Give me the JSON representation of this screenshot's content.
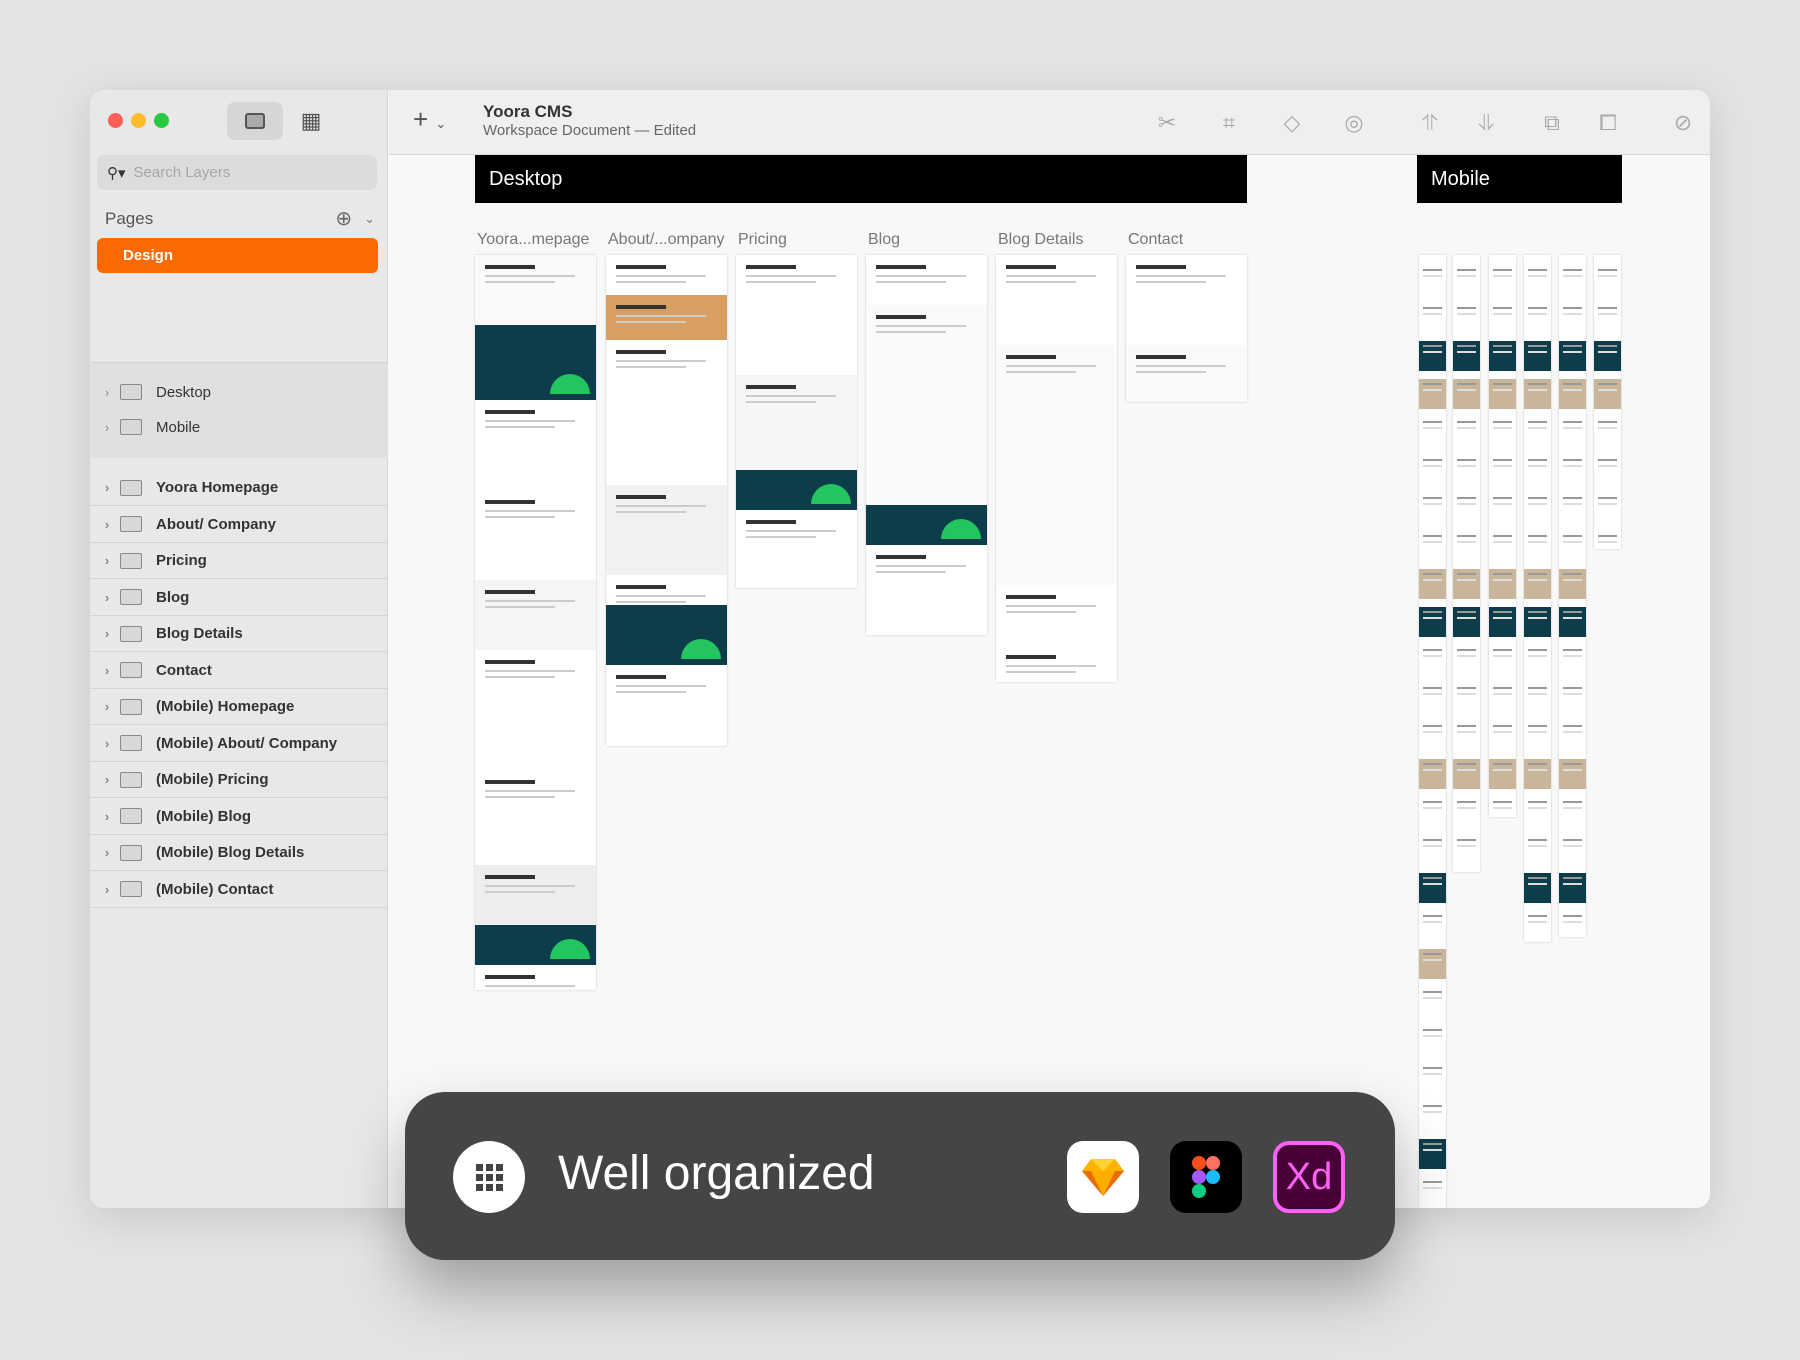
{
  "window": {
    "title": "Yoora CMS",
    "subtitle": "Workspace Document — Edited"
  },
  "sidebar": {
    "search_placeholder": "Search Layers",
    "pages_label": "Pages",
    "active_page": "Design",
    "groups": [
      {
        "label": "Desktop"
      },
      {
        "label": "Mobile"
      }
    ],
    "artboards": [
      {
        "label": "Yoora Homepage"
      },
      {
        "label": "About/ Company"
      },
      {
        "label": "Pricing"
      },
      {
        "label": "Blog"
      },
      {
        "label": "Blog Details"
      },
      {
        "label": "Contact"
      },
      {
        "label": "(Mobile) Homepage"
      },
      {
        "label": "(Mobile) About/ Company"
      },
      {
        "label": "(Mobile) Pricing"
      },
      {
        "label": "(Mobile) Blog"
      },
      {
        "label": "(Mobile) Blog Details"
      },
      {
        "label": "(Mobile) Contact"
      }
    ]
  },
  "toolbar": {
    "icons": [
      "scissors-icon",
      "frame-icon",
      "symbol-icon",
      "mask-icon",
      "forward-icon",
      "backward-icon",
      "group-icon",
      "ungroup-icon",
      "edit-icon",
      "resize-icon"
    ]
  },
  "canvas": {
    "desktop": {
      "label": "Desktop",
      "artboards": [
        {
          "label": "Yoora...mepage"
        },
        {
          "label": "About/...ompany"
        },
        {
          "label": "Pricing"
        },
        {
          "label": "Blog"
        },
        {
          "label": "Blog Details"
        },
        {
          "label": "Contact"
        }
      ]
    },
    "mobile": {
      "label": "Mobile"
    }
  },
  "overlay": {
    "text": "Well organized",
    "apps": [
      {
        "name": "Sketch"
      },
      {
        "name": "Figma"
      },
      {
        "name": "Adobe XD",
        "label": "Xd"
      }
    ]
  },
  "colors": {
    "accent": "#fa6a00",
    "dark_teal": "#0d3d4a",
    "green": "#22c55e"
  }
}
